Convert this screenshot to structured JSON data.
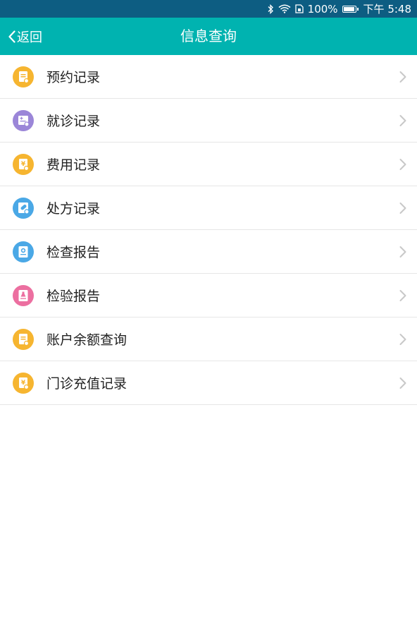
{
  "status_bar": {
    "battery_text": "100%",
    "time": "下午 5:48",
    "battery_level": 1.0,
    "icons": [
      "bluetooth-icon",
      "wifi-icon",
      "sim-icon",
      "battery-icon"
    ]
  },
  "nav": {
    "back_label": "返回",
    "title": "信息查询"
  },
  "menu": {
    "items": [
      {
        "label": "预约记录",
        "icon": "appointment-record-icon",
        "color": "#f6b530"
      },
      {
        "label": "就诊记录",
        "icon": "visit-record-icon",
        "color": "#9b86d8"
      },
      {
        "label": "费用记录",
        "icon": "fee-record-icon",
        "color": "#f6b530"
      },
      {
        "label": "处方记录",
        "icon": "prescription-record-icon",
        "color": "#4aa8e6"
      },
      {
        "label": "检查报告",
        "icon": "examination-report-icon",
        "color": "#4aa8e6"
      },
      {
        "label": "检验报告",
        "icon": "lab-test-report-icon",
        "color": "#ec6fa0"
      },
      {
        "label": "账户余额查询",
        "icon": "account-balance-icon",
        "color": "#f6b530"
      },
      {
        "label": "门诊充值记录",
        "icon": "outpatient-recharge-icon",
        "color": "#f6b530"
      }
    ]
  },
  "colors": {
    "status_bar": "#0d5d82",
    "nav_bar": "#00b3b0",
    "divider": "#e6e6e6",
    "chevron": "#c8c8c8"
  }
}
